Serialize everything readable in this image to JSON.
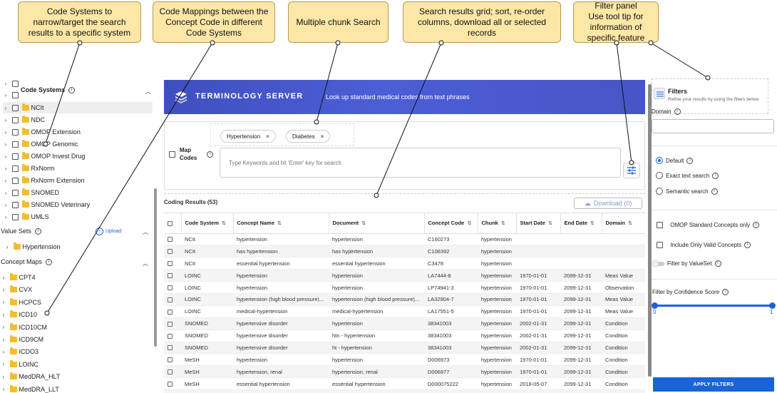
{
  "callouts": [
    {
      "id": "code-systems",
      "text": "Code Systems to narrow/target the search results to a specific system"
    },
    {
      "id": "code-mappings",
      "text": "Code Mappings between the Concept Code in different Code Systems"
    },
    {
      "id": "multi-chunk",
      "text": "Multiple chunk Search"
    },
    {
      "id": "results-grid",
      "text": "Search results grid; sort, re-order columns, download all or selected records"
    },
    {
      "id": "filter-panel",
      "text": "Filter panel\nUse tool tip for information of specific feature"
    }
  ],
  "sidebar": {
    "code_systems_title": "Code Systems",
    "code_systems": [
      "NCIt",
      "NDC",
      "OMOP Extension",
      "OMOP Genomic",
      "OMOP Invest Drug",
      "RxNorm",
      "RxNorm Extension",
      "SNOMED",
      "SNOMED Veterinary",
      "UMLS"
    ],
    "value_sets_title": "Value Sets",
    "upload_label": "Upload",
    "value_sets": [
      "Hypertension"
    ],
    "concept_maps_title": "Concept Maps",
    "concept_maps": [
      "CPT4",
      "CVX",
      "HCPCS",
      "ICD10",
      "ICD10CM",
      "ICD9CM",
      "ICDO3",
      "LOINC",
      "MedDRA_HLT",
      "MedDRA_LLT"
    ]
  },
  "banner": {
    "brand": "TERMINOLOGY SERVER",
    "tagline": "Look up standard medical codes from text phrases"
  },
  "search": {
    "chips": [
      "Hypertension",
      "Diabetes"
    ],
    "map_codes_label": "Map\nCodes",
    "placeholder": "Type Keywords and hit 'Enter' key for search"
  },
  "results": {
    "title": "Coding Results (53)",
    "download_label": "Download (0)",
    "columns": [
      "Code System",
      "Concept Name",
      "Document",
      "Concept Code",
      "Chunk",
      "Start Date",
      "End Date",
      "Domain"
    ],
    "rows": [
      [
        "NCIt",
        "hypertension",
        "hypertension",
        "C160273",
        "hypertension",
        "",
        "",
        ""
      ],
      [
        "NCIt",
        "has hypertension",
        "has hypertension",
        "C106392",
        "hypertension",
        "",
        "",
        ""
      ],
      [
        "NCIt",
        "essential hypertension",
        "essential hypertension",
        "C3478",
        "hypertension",
        "",
        "",
        ""
      ],
      [
        "LOINC",
        "hypertension",
        "hypertension",
        "LA7444-8",
        "hypertension",
        "1970-01-01",
        "2099-12-31",
        "Meas Value"
      ],
      [
        "LOINC",
        "hypertension",
        "hypertension",
        "LP74941-3",
        "hypertension",
        "1970-01-01",
        "2099-12-31",
        "Observation"
      ],
      [
        "LOINC",
        "hypertension (high blood pressure)...",
        "hypertension (high blood pressure)...",
        "LA32904-7",
        "hypertension",
        "1970-01-01",
        "2099-12-31",
        "Meas Value"
      ],
      [
        "LOINC",
        "medical-hypertension",
        "medical-hypertension",
        "LA17551-5",
        "hypertension",
        "1970-01-01",
        "2099-12-31",
        "Meas Value"
      ],
      [
        "SNOMED",
        "hypertensive disorder",
        "hypertension",
        "38341003",
        "hypertension",
        "2002-01-31",
        "2099-12-31",
        "Condition"
      ],
      [
        "SNOMED",
        "hypertensive disorder",
        "htn - hypertension",
        "38341003",
        "hypertension",
        "2002-01-31",
        "2099-12-31",
        "Condition"
      ],
      [
        "SNOMED",
        "hypertensive disorder",
        "ht - hypertension",
        "38341003",
        "hypertension",
        "2002-01-31",
        "2099-12-31",
        "Condition"
      ],
      [
        "MeSH",
        "hypertension",
        "hypertension",
        "D006973",
        "hypertension",
        "1970-01-01",
        "2099-12-31",
        "Condition"
      ],
      [
        "MeSH",
        "hypertension, renal",
        "hypertension, renal",
        "D006977",
        "hypertension",
        "1970-01-01",
        "2099-12-31",
        "Condition"
      ],
      [
        "MeSH",
        "essential hypertension",
        "essential hypertension",
        "D000075222",
        "hypertension",
        "2018-05-07",
        "2099-12-31",
        "Condition"
      ]
    ]
  },
  "filters": {
    "title": "Filters",
    "subtitle": "Refine your results by using the filters below.",
    "domain_label": "Domain",
    "search_modes": [
      "Default",
      "Exact text search",
      "Semantic search"
    ],
    "selected_mode": "Default",
    "omop_label": "OMOP Standard Concepts only",
    "valid_label": "Include Only Valid Concepts",
    "valueset_label": "Filter by ValueSet",
    "confidence_label": "Filter by Confidence Score",
    "confidence_min": "0",
    "confidence_max": "1",
    "confidence_range": [
      0,
      1
    ],
    "apply_label": "APPLY FILTERS"
  },
  "colors": {
    "accent": "#1a63d8",
    "banner": "#4656c7",
    "folder": "#f3bd2c",
    "callout": "#fce7a6"
  }
}
